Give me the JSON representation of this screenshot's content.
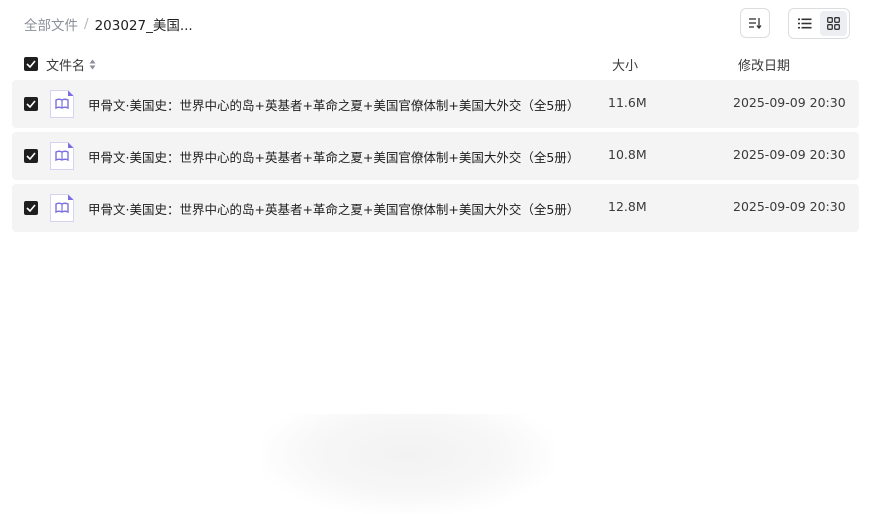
{
  "breadcrumb": {
    "root": "全部文件",
    "separator": "/",
    "current": "203027_美国..."
  },
  "toolbar": {
    "sort_icon": "sort-descending-icon",
    "list_view_icon": "list-view-icon",
    "grid_view_icon": "grid-view-icon",
    "selected_view": "grid"
  },
  "table": {
    "headers": {
      "name": "文件名",
      "size": "大小",
      "date": "修改日期"
    },
    "rows": [
      {
        "name": "甲骨文·美国史：世界中心的岛+英基者+革命之夏+美国官僚体制+美国大外交（全5册）...",
        "size": "11.6M",
        "date": "2025-09-09 20:30",
        "checked": true
      },
      {
        "name": "甲骨文·美国史：世界中心的岛+英基者+革命之夏+美国官僚体制+美国大外交（全5册）...",
        "size": "10.8M",
        "date": "2025-09-09 20:30",
        "checked": true
      },
      {
        "name": "甲骨文·美国史：世界中心的岛+英基者+革命之夏+美国官僚体制+美国大外交（全5册）...",
        "size": "12.8M",
        "date": "2025-09-09 20:30",
        "checked": true
      }
    ]
  },
  "colors": {
    "row_background": "#f4f4f5",
    "checkbox": "#1f1f1f",
    "file_icon_accent": "#7b6fe0"
  }
}
